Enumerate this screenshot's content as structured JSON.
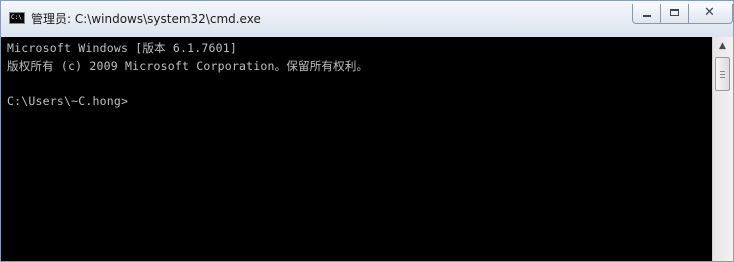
{
  "window": {
    "title": "管理员: C:\\windows\\system32\\cmd.exe",
    "icon_name": "cmd-icon",
    "icon_text": "C:\\",
    "controls": {
      "minimize_icon": "minimize-icon",
      "maximize_icon": "maximize-icon",
      "close_icon": "close-icon",
      "close_glyph": "✕"
    }
  },
  "console": {
    "background_color": "#000000",
    "text_color": "#c0c0c0",
    "lines": [
      "Microsoft Windows [版本 6.1.7601]",
      "版权所有 (c) 2009 Microsoft Corporation。保留所有权利。",
      "",
      "C:\\Users\\~C.hong>"
    ]
  },
  "scrollbar": {
    "up_arrow_icon": "scroll-up-arrow-icon",
    "up_arrow_glyph": "▲"
  }
}
